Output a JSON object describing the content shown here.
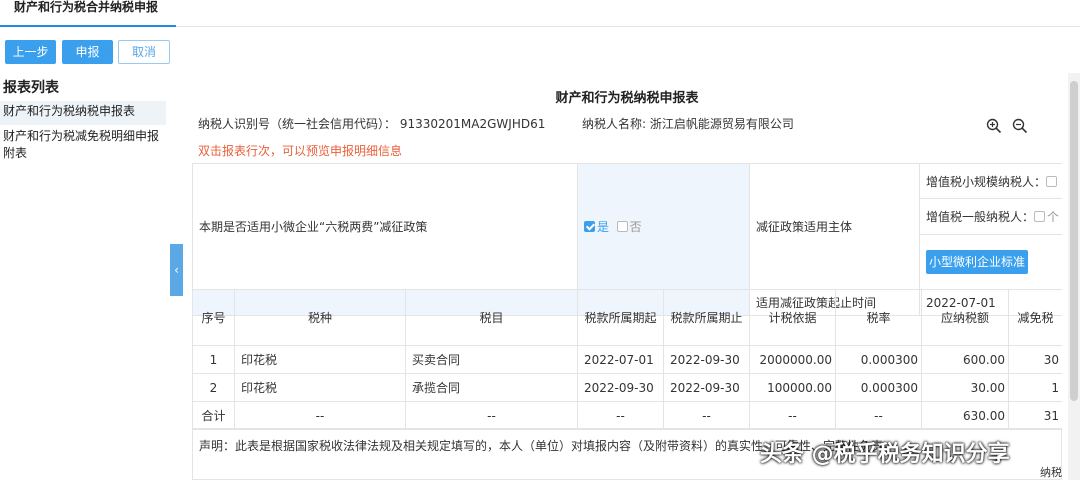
{
  "tab": {
    "title": "财产和行为税合并纳税申报"
  },
  "toolbar": {
    "prev_label": "上一步",
    "submit_label": "申报",
    "cancel_label": "取消"
  },
  "sidebar": {
    "title": "报表列表",
    "items": [
      {
        "label": "财产和行为税纳税申报表"
      },
      {
        "label": "财产和行为税减免税明细申报附表"
      }
    ]
  },
  "form": {
    "title": "财产和行为税纳税申报表",
    "taxpayer_id_label": "纳税人识别号（统一社会信用代码）：",
    "taxpayer_id": "91330201MA2GWJHD61",
    "taxpayer_name_label": "纳税人名称:",
    "taxpayer_name": "浙江启帆能源贸易有限公司",
    "hint": "双击报表行次，可以预览申报明细信息",
    "policy": {
      "question": "本期是否适用小微企业“六税两费”减征政策",
      "yes": "是",
      "no": "否",
      "yes_checked": true,
      "subject_label": "减征政策适用主体",
      "small_scale_label": "增值税小规模纳税人：",
      "general_label": "增值税一般纳税人：",
      "general_option": "个",
      "standard_button": "小型微利企业标准",
      "period_label": "适用减征政策起止时间",
      "period_start": "2022-07-01"
    },
    "columns": [
      "序号",
      "税种",
      "税目",
      "税款所属期起",
      "税款所属期止",
      "计税依据",
      "税率",
      "应纳税额",
      "减免税"
    ],
    "rows": [
      {
        "no": "1",
        "tax_type": "印花税",
        "item": "买卖合同",
        "from": "2022-07-01",
        "to": "2022-09-30",
        "basis": "2000000.00",
        "rate": "0.000300",
        "payable": "600.00",
        "relief": "30"
      },
      {
        "no": "2",
        "tax_type": "印花税",
        "item": "承揽合同",
        "from": "2022-09-30",
        "to": "2022-09-30",
        "basis": "100000.00",
        "rate": "0.000300",
        "payable": "30.00",
        "relief": "1"
      }
    ],
    "total": {
      "label": "合计",
      "tax_type": "--",
      "item": "--",
      "from": "--",
      "to": "--",
      "basis": "--",
      "rate": "--",
      "payable": "630.00",
      "relief": "31"
    },
    "declaration": "声明：此表是根据国家税收法律法规及相关规定填写的，本人（单位）对填报内容（及附带资料）的真实性、可靠性、完整性负责。"
  },
  "watermark": "头条 @税乎税务知识分享",
  "corner_text": "纳税"
}
